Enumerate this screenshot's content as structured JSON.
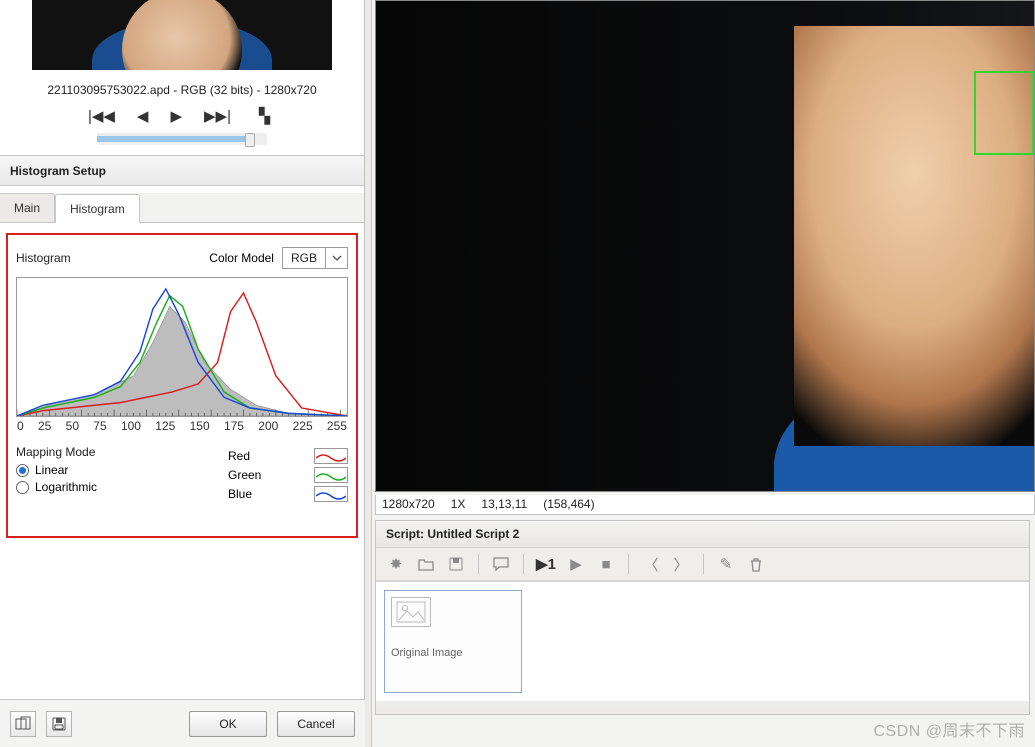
{
  "thumbnail": {
    "file_label": "221103095753022.apd - RGB (32 bits) - 1280x720"
  },
  "section": {
    "title": "Histogram Setup"
  },
  "tabs": {
    "main": "Main",
    "histogram": "Histogram"
  },
  "hist": {
    "label": "Histogram",
    "color_model_label": "Color Model",
    "color_model_value": "RGB",
    "mapping_label": "Mapping Mode",
    "linear": "Linear",
    "logarithmic": "Logarithmic",
    "legend_red": "Red",
    "legend_green": "Green",
    "legend_blue": "Blue"
  },
  "axis": {
    "t0": "0",
    "t1": "25",
    "t2": "50",
    "t3": "75",
    "t4": "100",
    "t5": "125",
    "t6": "150",
    "t7": "175",
    "t8": "200",
    "t9": "225",
    "t10": "255"
  },
  "buttons": {
    "ok": "OK",
    "cancel": "Cancel"
  },
  "status": {
    "dims": "1280x720",
    "zoom": "1X",
    "rgb": "13,13,11",
    "coords": "(158,464)"
  },
  "script": {
    "title": "Script: Untitled Script 2",
    "tile": "Original Image"
  },
  "play1": "▶1",
  "watermark": "CSDN @周末不下雨",
  "chart_data": {
    "type": "line",
    "title": "Histogram",
    "xlabel": "",
    "ylabel": "",
    "xlim": [
      0,
      255
    ],
    "ylim": [
      0,
      100
    ],
    "xticks": [
      0,
      25,
      50,
      75,
      100,
      125,
      150,
      175,
      200,
      225,
      255
    ],
    "series": [
      {
        "name": "Red",
        "color": "#d81f1f",
        "x": [
          0,
          20,
          40,
          60,
          80,
          100,
          120,
          140,
          155,
          165,
          175,
          185,
          200,
          220,
          255
        ],
        "y": [
          0,
          4,
          6,
          8,
          10,
          14,
          18,
          24,
          40,
          78,
          92,
          70,
          30,
          6,
          0
        ]
      },
      {
        "name": "Green",
        "color": "#1fae1f",
        "x": [
          0,
          20,
          40,
          60,
          80,
          95,
          108,
          118,
          128,
          140,
          160,
          180,
          210,
          255
        ],
        "y": [
          0,
          6,
          10,
          14,
          22,
          40,
          70,
          90,
          82,
          50,
          18,
          6,
          2,
          0
        ]
      },
      {
        "name": "Blue",
        "color": "#1b49d6",
        "x": [
          0,
          20,
          40,
          60,
          80,
          95,
          105,
          115,
          125,
          140,
          160,
          180,
          210,
          255
        ],
        "y": [
          0,
          8,
          12,
          16,
          26,
          48,
          80,
          95,
          76,
          40,
          14,
          6,
          2,
          0
        ]
      }
    ],
    "fill_gray": {
      "x": [
        0,
        30,
        60,
        90,
        105,
        118,
        130,
        145,
        165,
        185,
        210,
        255
      ],
      "y": [
        0,
        10,
        16,
        30,
        55,
        82,
        70,
        40,
        20,
        8,
        2,
        0
      ]
    }
  }
}
